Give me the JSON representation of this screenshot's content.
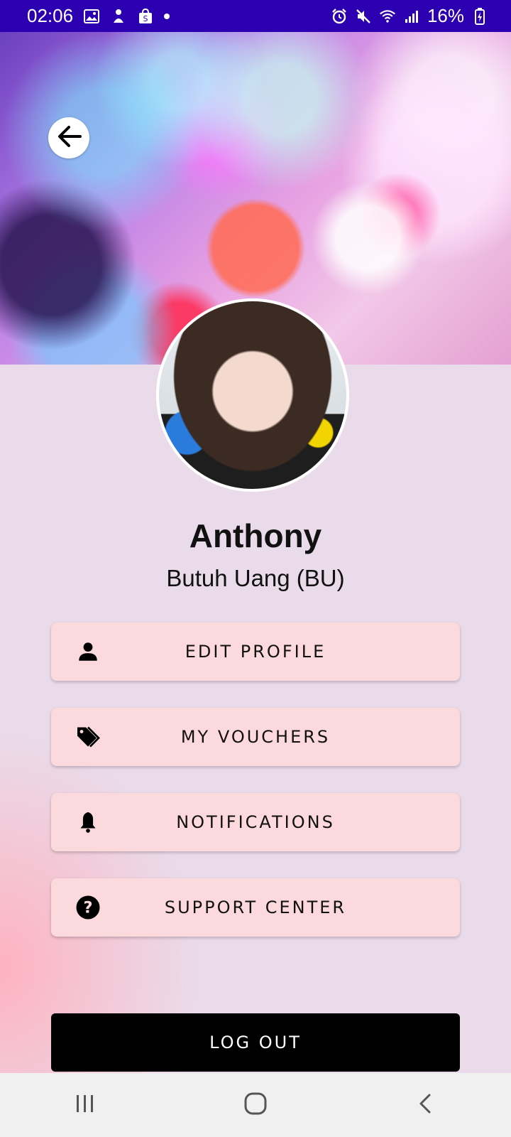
{
  "status_bar": {
    "time": "02:06",
    "battery": "16%"
  },
  "cover": {
    "back_icon": "arrow-left-icon"
  },
  "profile": {
    "name": "Anthony",
    "subtitle": "Butuh Uang (BU)"
  },
  "menu": [
    {
      "label": "EDIT PROFILE",
      "icon": "person-icon"
    },
    {
      "label": "MY VOUCHERS",
      "icon": "tags-icon"
    },
    {
      "label": "NOTIFICATIONS",
      "icon": "bell-icon"
    },
    {
      "label": "SUPPORT CENTER",
      "icon": "help-circle-icon"
    }
  ],
  "logout_label": "LOG OUT",
  "nav": {
    "recent": "recent-apps-icon",
    "home": "home-icon",
    "back": "back-icon"
  },
  "colors": {
    "status_bar": "#2c00b0",
    "menu_button": "#fbd9dc",
    "logout_button": "#000000",
    "background": "#eadbea"
  }
}
